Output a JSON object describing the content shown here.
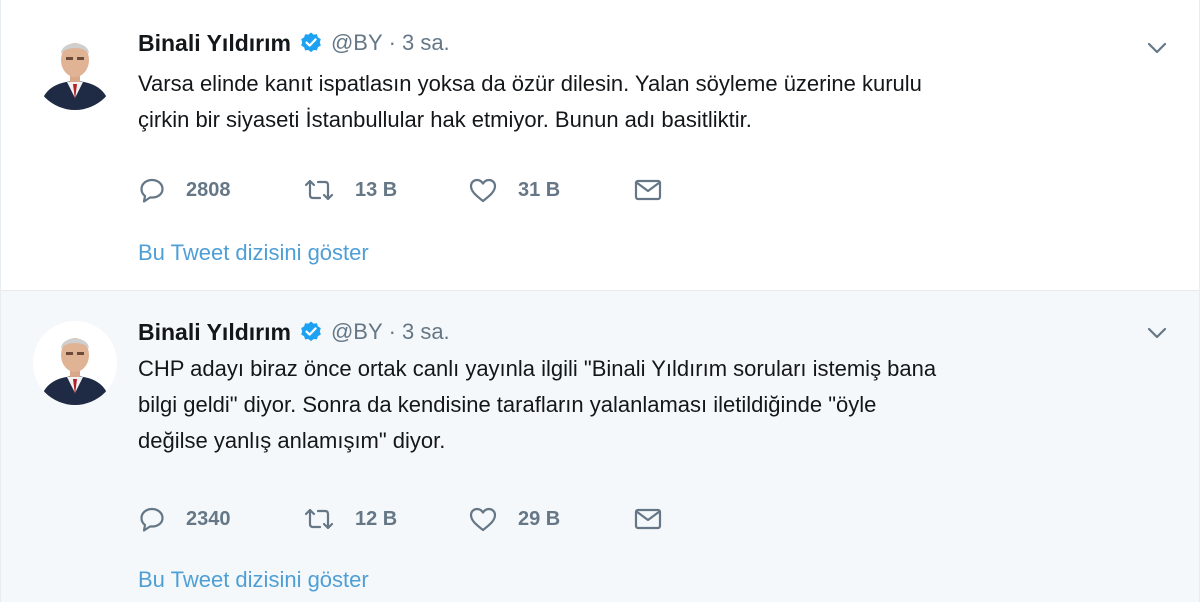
{
  "tweets": [
    {
      "author": {
        "name": "Binali Yıldırım",
        "handle": "@BY",
        "verified": true
      },
      "separator": "·",
      "time": "3 sa.",
      "text_lines": [
        "Varsa elinde kanıt ispatlasın yoksa da özür dilesin. Yalan söyleme üzerine kurulu",
        "çirkin bir siyaseti İstanbullular hak etmiyor. Bunun adı basitliktir."
      ],
      "stats": {
        "replies": "2808",
        "retweets": "13 B",
        "likes": "31 B"
      },
      "thread_link": "Bu Tweet dizisini göster"
    },
    {
      "author": {
        "name": "Binali Yıldırım",
        "handle": "@BY",
        "verified": true
      },
      "separator": "·",
      "time": "3 sa.",
      "text_lines": [
        "CHP adayı biraz önce ortak canlı yayınla ilgili \"Binali Yıldırım soruları istemiş bana",
        "bilgi geldi\" diyor. Sonra da kendisine tarafların yalanlaması iletildiğinde \"öyle",
        "değilse yanlış anlamışım\" diyor."
      ],
      "stats": {
        "replies": "2340",
        "retweets": "12 B",
        "likes": "29 B"
      },
      "thread_link": "Bu Tweet dizisini göster"
    }
  ],
  "colors": {
    "link": "#4e9fd6",
    "verified": "#1da1f2",
    "muted": "#657786",
    "text": "#14171a",
    "highlight_bg": "#f5f8fa"
  },
  "icons": {
    "reply": "reply-icon",
    "retweet": "retweet-icon",
    "like": "heart-icon",
    "dm": "envelope-icon",
    "caret": "chevron-down-icon",
    "verified": "verified-badge-icon"
  }
}
